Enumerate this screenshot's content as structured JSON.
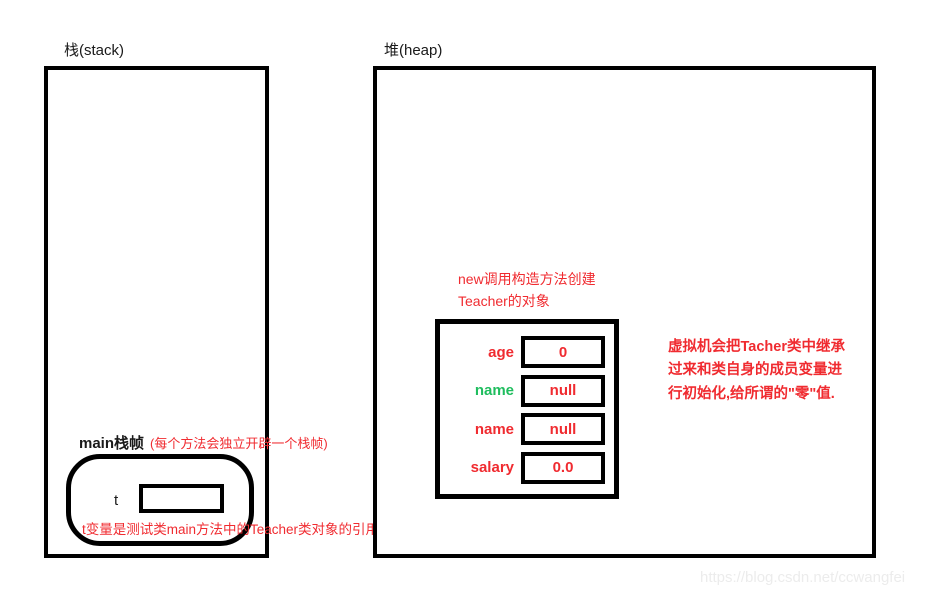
{
  "diagram": {
    "regions": {
      "stack": {
        "title": "栈(stack)"
      },
      "heap": {
        "title": "堆(heap)"
      }
    },
    "stack": {
      "frame": {
        "name": "main栈帧",
        "note": "(每个方法会独立开辟一个栈帧)",
        "variable_label": "t",
        "variable_value": ""
      },
      "reference_note": "t变量是测试类main方法中的Teacher类对象的引用"
    },
    "heap": {
      "new_object_note": "new调用构造方法创建Teacher的对象",
      "object": {
        "fields": [
          {
            "name": "age",
            "name_color": "#f02b30",
            "value": "0"
          },
          {
            "name": "name",
            "name_color": "#1fbd5e",
            "value": "null"
          },
          {
            "name": "name",
            "name_color": "#f02b30",
            "value": "null"
          },
          {
            "name": "salary",
            "name_color": "#f02b30",
            "value": "0.0"
          }
        ]
      },
      "init_note": "虚拟机会把Tacher类中继承过来和类自身的成员变量进行初始化,给所谓的\"零\"值."
    },
    "watermark": "https://blog.csdn.net/ccwangfei",
    "colors": {
      "annotation_red": "#f02b30",
      "green_label": "#1fbd5e",
      "outline_black": "#000000",
      "watermark_gray": "#ececec"
    }
  }
}
